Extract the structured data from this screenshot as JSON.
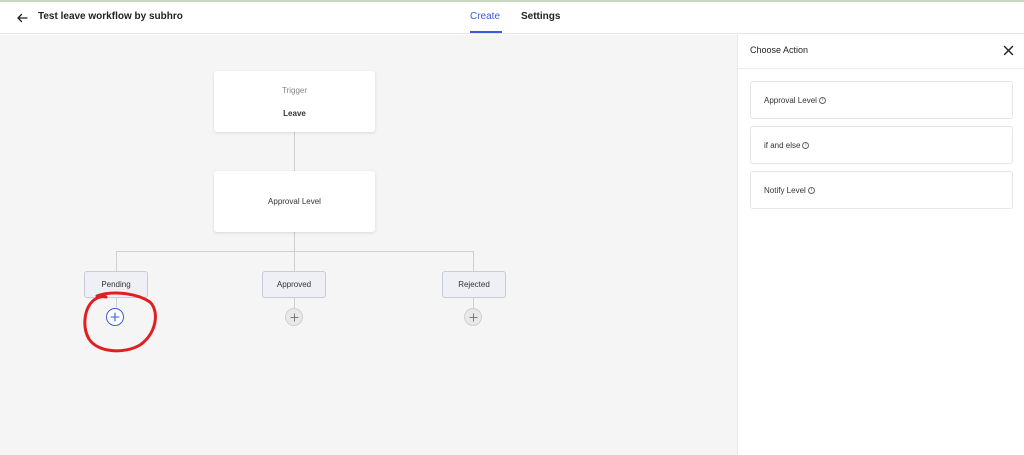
{
  "header": {
    "title": "Test leave workflow by subhro",
    "back_icon": "arrow-left-icon",
    "tabs": [
      {
        "label": "Create",
        "active": true
      },
      {
        "label": "Settings",
        "active": false
      }
    ],
    "accent_color": "#3b5bdb"
  },
  "workflow": {
    "trigger": {
      "label": "Trigger",
      "value": "Leave"
    },
    "approval_node": {
      "label": "Approval Level"
    },
    "branches": [
      {
        "label": "Pending"
      },
      {
        "label": "Approved"
      },
      {
        "label": "Rejected"
      }
    ],
    "add_icon": "plus-icon"
  },
  "panel": {
    "title": "Choose Action",
    "close_icon": "close-icon",
    "actions": [
      {
        "label": "Approval Level",
        "icon": "info-icon"
      },
      {
        "label": "if and else",
        "icon": "info-icon"
      },
      {
        "label": "Notify Level",
        "icon": "info-icon"
      }
    ]
  },
  "colors": {
    "canvas_bg": "#f5f5f5",
    "annotation": "#e02020"
  }
}
